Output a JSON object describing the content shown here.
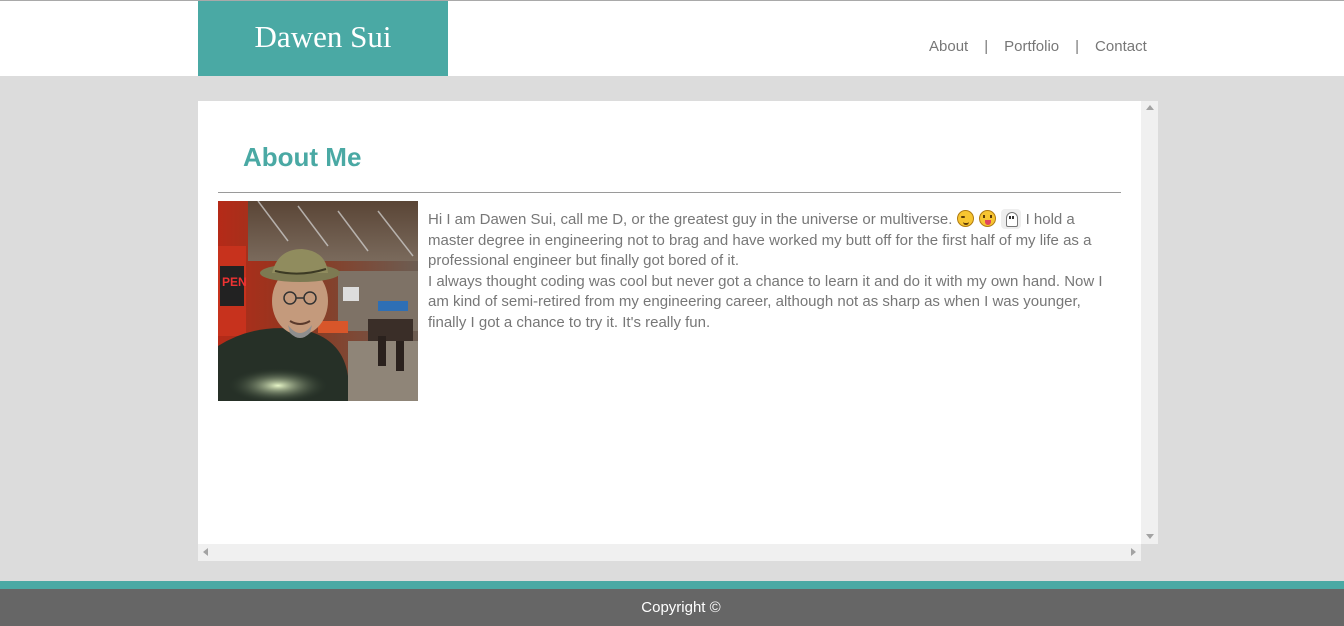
{
  "header": {
    "brand": "Dawen Sui",
    "nav": [
      {
        "label": "About"
      },
      {
        "label": "Portfolio"
      },
      {
        "label": "Contact"
      }
    ],
    "separator": "|"
  },
  "about": {
    "title": "About Me",
    "paragraph1": "Hi I am Dawen Sui, call me D, or the greatest guy in the universe or multiverse.",
    "paragraph1_cont": "I hold a master degree in engineering not to brag and have worked my butt off for the first half of my life as a professional engineer but finally got bored of it.",
    "paragraph2": "I always thought coding was cool but never got a chance to learn it and do it with my own hand. Now I am kind of semi-retired from my engineering career, although not as sharp as when I was younger, finally I got a chance to try it. It's really fun.",
    "emojis": [
      "wink-face-icon",
      "tongue-face-icon",
      "ghost-icon"
    ]
  },
  "footer": {
    "copyright": "Copyright ©"
  },
  "colors": {
    "accent": "#4aa9a4",
    "page_background": "#dcdcdc",
    "footer_background": "#666666",
    "text": "#777777"
  }
}
